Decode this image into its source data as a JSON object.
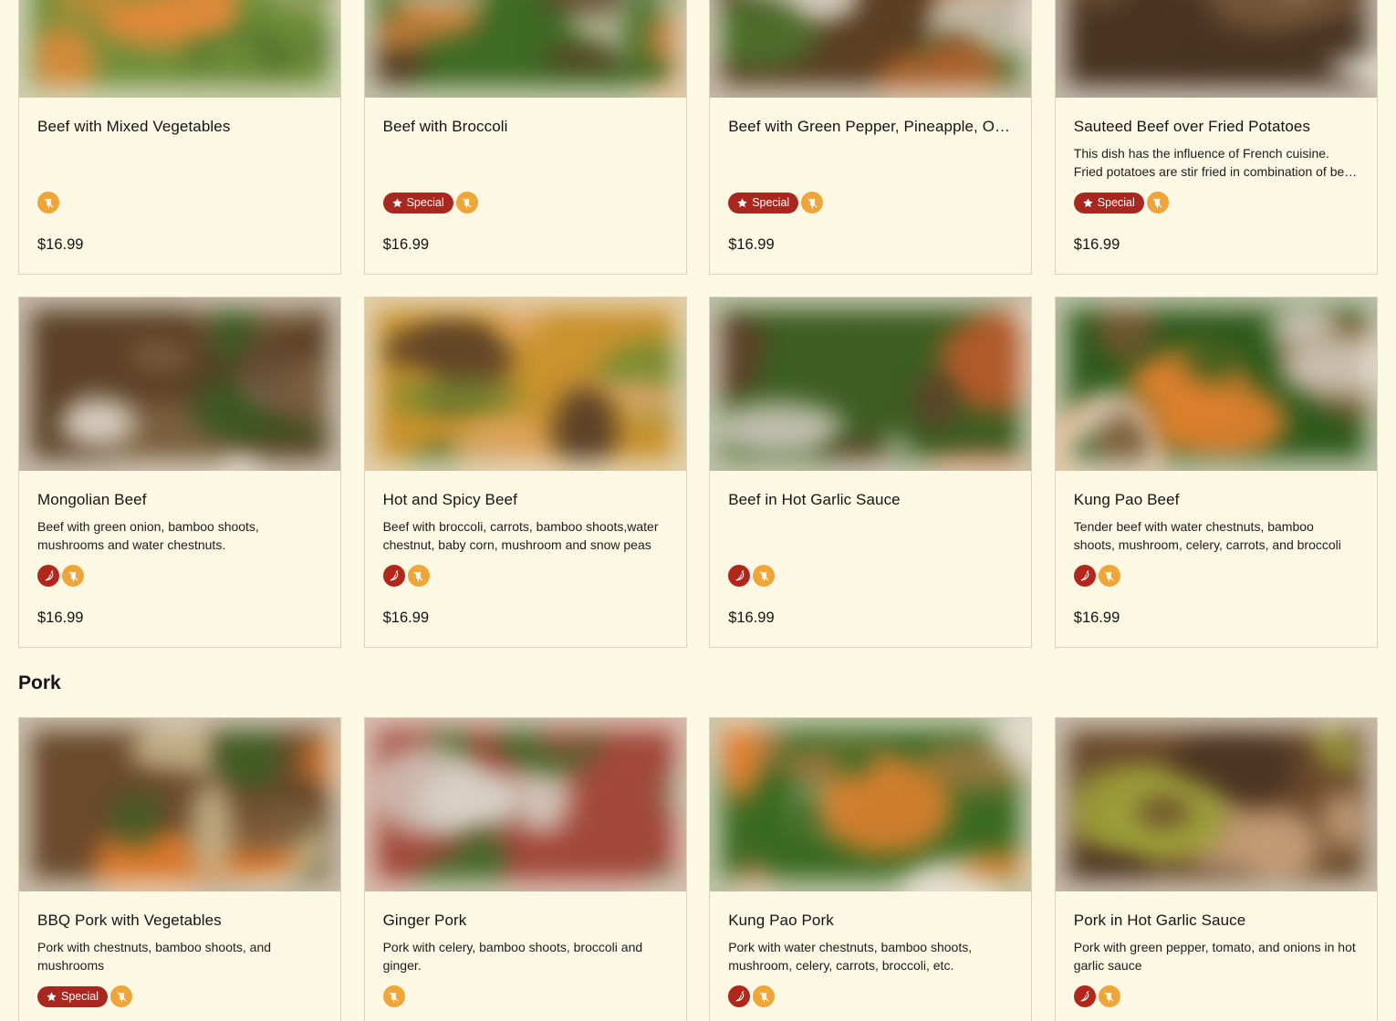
{
  "colors": {
    "page_background": "#fdf8e4",
    "special_badge": "#a8271f",
    "spicy_icon": "#b2271c",
    "grain_icon": "#eea63a"
  },
  "sections": [
    {
      "name": "",
      "items": [
        {
          "name": "Beef with Mixed Vegetables",
          "description": "",
          "special": false,
          "spicy": false,
          "gluten": true,
          "price": "$16.99",
          "special_label": "",
          "photo_palette": [
            "#6f8f3a",
            "#e08a3a",
            "#4d6b2a",
            "#c9b89a"
          ]
        },
        {
          "name": "Beef with Broccoli",
          "description": "",
          "special": true,
          "spicy": false,
          "gluten": true,
          "price": "$16.99",
          "special_label": "Special",
          "photo_palette": [
            "#3f6b24",
            "#d9823d",
            "#c8c2a8",
            "#5a3e26"
          ]
        },
        {
          "name": "Beef with Green Pepper, Pineapple, Onions and Tomato",
          "description": "",
          "special": true,
          "spicy": false,
          "gluten": true,
          "price": "$16.99",
          "special_label": "Special",
          "photo_palette": [
            "#5a3f24",
            "#b8662e",
            "#4d6e2b",
            "#d8d2c4"
          ]
        },
        {
          "name": "Sauteed Beef over Fried Potatoes",
          "description": "This dish has the influence of French cuisine. Fried potatoes are stir fried in combination of beef and onions.",
          "special": true,
          "spicy": false,
          "gluten": true,
          "price": "$16.99",
          "special_label": "Special",
          "photo_palette": [
            "#4a3422",
            "#7a5a3c",
            "#d4cdbd",
            "#3a2a1c"
          ]
        }
      ]
    },
    {
      "name": "",
      "items": [
        {
          "name": "Mongolian Beef",
          "description": "Beef with green onion, bamboo shoots, mushrooms and water chestnuts.",
          "special": false,
          "spicy": true,
          "gluten": true,
          "price": "$16.99",
          "special_label": "",
          "photo_palette": [
            "#5c4128",
            "#7b6040",
            "#3b5a23",
            "#d9cfbf"
          ]
        },
        {
          "name": "Hot and Spicy Beef",
          "description": "Beef with broccoli, carrots, bamboo shoots,water chestnut, baby corn, mushroom and snow peas",
          "special": false,
          "spicy": true,
          "gluten": true,
          "price": "$16.99",
          "special_label": "",
          "photo_palette": [
            "#c9932e",
            "#5d4227",
            "#6c8a31",
            "#e0a86a"
          ]
        },
        {
          "name": "Beef in Hot Garlic Sauce",
          "description": "",
          "special": false,
          "spicy": true,
          "gluten": true,
          "price": "$16.99",
          "special_label": "",
          "photo_palette": [
            "#3d5e22",
            "#5e4129",
            "#b35a2a",
            "#d6d0c4"
          ]
        },
        {
          "name": "Kung Pao Beef",
          "description": "Tender beef with water chestnuts, bamboo shoots, mushroom, celery, carrots, and broccoli",
          "special": false,
          "spicy": true,
          "gluten": true,
          "price": "$16.99",
          "special_label": "",
          "photo_palette": [
            "#2f5a1c",
            "#7a5530",
            "#e4822e",
            "#d9d3c5"
          ]
        }
      ]
    },
    {
      "name": "Pork",
      "items": [
        {
          "name": "BBQ Pork with Vegetables",
          "description": "Pork with chestnuts, bamboo shoots, and mushrooms",
          "special": true,
          "spicy": false,
          "gluten": true,
          "price": "",
          "special_label": "Special",
          "photo_palette": [
            "#6a4a2c",
            "#c8b48a",
            "#3f5e23",
            "#d9782d"
          ]
        },
        {
          "name": "Ginger Pork",
          "description": "Pork with celery, bamboo shoots, broccoli and ginger.",
          "special": false,
          "spicy": false,
          "gluten": true,
          "price": "",
          "special_label": "",
          "photo_palette": [
            "#a2493b",
            "#3f6d2a",
            "#8a7a5e",
            "#d9d3c8"
          ]
        },
        {
          "name": "Kung Pao Pork",
          "description": "Pork with water chestnuts, bamboo shoots, mushroom, celery, carrots, broccoli, etc.",
          "special": false,
          "spicy": true,
          "gluten": true,
          "price": "",
          "special_label": "",
          "photo_palette": [
            "#3b6a22",
            "#a57a45",
            "#e7822f",
            "#d9d2c2"
          ]
        },
        {
          "name": "Pork in Hot Garlic Sauce",
          "description": "Pork with green pepper, tomato, and onions in hot garlic sauce",
          "special": false,
          "spicy": true,
          "gluten": true,
          "price": "",
          "special_label": "",
          "photo_palette": [
            "#6a4a2c",
            "#9ea03a",
            "#4c3422",
            "#c9a27a"
          ]
        }
      ]
    }
  ],
  "icons": {
    "special": "star-icon",
    "spicy": "chili-pepper-icon",
    "gluten": "wheat-icon"
  }
}
